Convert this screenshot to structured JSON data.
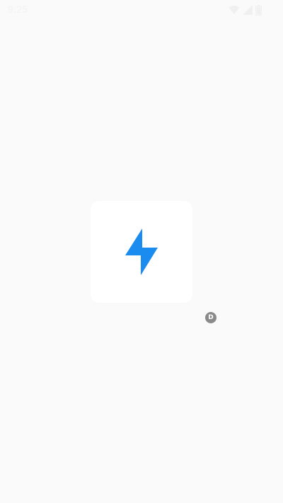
{
  "status_bar": {
    "time": "9:25",
    "icons": [
      "wifi-icon",
      "signal-icon",
      "battery-icon"
    ],
    "icon_color": "#f0f0f0"
  },
  "splash": {
    "logo_icon": "lightning-bolt-icon",
    "logo_color": "#1a8cf0",
    "card_color": "#ffffff",
    "background_color": "#fafafa"
  },
  "debug_badge": {
    "label": "D",
    "color": "#8a8a8a"
  }
}
